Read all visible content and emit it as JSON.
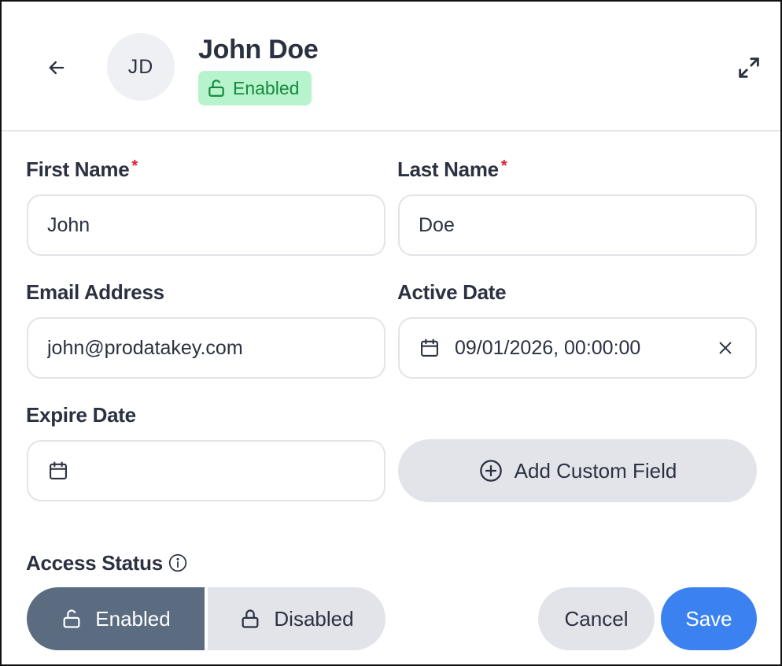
{
  "header": {
    "avatar_initials": "JD",
    "name": "John Doe",
    "status_badge": "Enabled",
    "badge_bg": "#b7f3cd",
    "badge_text_color": "#158a3c"
  },
  "form": {
    "first_name": {
      "label": "First Name",
      "required_mark": "*",
      "value": "John"
    },
    "last_name": {
      "label": "Last Name",
      "required_mark": "*",
      "value": "Doe"
    },
    "email": {
      "label": "Email Address",
      "value": "john@prodatakey.com"
    },
    "active_date": {
      "label": "Active Date",
      "value": "09/01/2026, 00:00:00"
    },
    "expire_date": {
      "label": "Expire Date",
      "value": ""
    },
    "add_custom_field_label": "Add Custom Field"
  },
  "access_status": {
    "label": "Access Status",
    "options": [
      "Enabled",
      "Disabled"
    ],
    "selected": "Enabled"
  },
  "actions": {
    "cancel_label": "Cancel",
    "save_label": "Save"
  },
  "icons": {
    "back": "arrow-left-icon",
    "expand": "expand-icon",
    "calendar": "calendar-icon",
    "clear": "close-icon",
    "add": "plus-circle-icon",
    "info": "info-icon",
    "unlock": "unlock-icon",
    "lock": "lock-icon"
  },
  "colors": {
    "primary": "#3b82f0",
    "selected_segment": "#5b6b80",
    "required": "#e11d2e"
  }
}
